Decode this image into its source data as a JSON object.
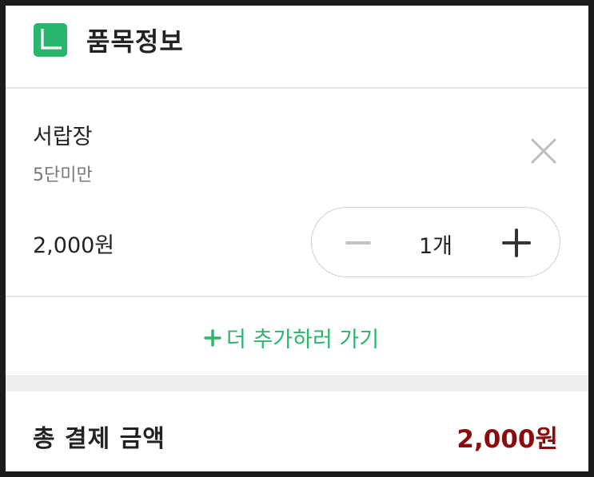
{
  "header": {
    "title": "품목정보",
    "icon": "book-icon",
    "accent_color": "#27b66b"
  },
  "item": {
    "name": "서랍장",
    "option": "5단미만",
    "price": "2,000원",
    "remove_icon": "close-icon",
    "quantity": {
      "value": "1개",
      "minus_icon": "minus-icon",
      "plus_icon": "plus-icon"
    }
  },
  "add_more": {
    "label": "더 추가하러 가기",
    "icon": "plus-icon",
    "color": "#27b66b"
  },
  "total": {
    "label": "총 결제 금액",
    "value": "2,000원",
    "color": "#8b0c0c"
  }
}
